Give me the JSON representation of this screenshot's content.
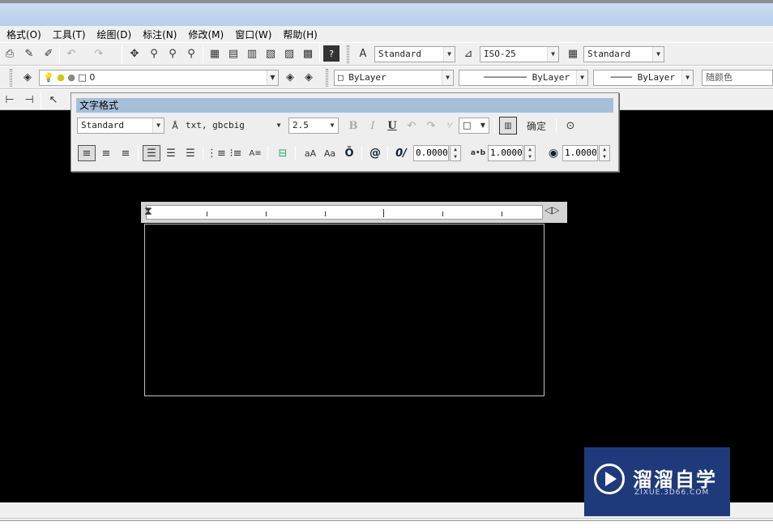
{
  "menubar": {
    "items": [
      "格式(O)",
      "工具(T)",
      "绘图(D)",
      "标注(N)",
      "修改(M)",
      "窗口(W)",
      "帮助(H)"
    ]
  },
  "toolbar_styles": {
    "text_style": "Standard",
    "dim_style": "ISO-25",
    "table_style": "Standard"
  },
  "toolbar_layers": {
    "current_layer": "0",
    "color": "ByLayer",
    "linetype": "ByLayer",
    "lineweight": "ByLayer",
    "plot_style": "随颜色"
  },
  "text_format": {
    "title": "文字格式",
    "style": "Standard",
    "font": "txt, gbcbig",
    "height": "2.5",
    "ok_label": "确定",
    "bold": "B",
    "italic": "I",
    "underline": "U",
    "oblique_angle": "0.0000",
    "tracking": "1.0000",
    "width_factor": "1.0000",
    "symbol": "@",
    "oblique_icon": "0/",
    "tracking_icon": "a•b",
    "upper_lower": "aA",
    "lower": "Aa"
  },
  "watermark": {
    "name": "溜溜自学",
    "url": "ZIXUE.3D66.COM"
  },
  "colors": {
    "canvas": "#000000",
    "titlebar": "#b7cfea",
    "dialog_title": "#a6bfd9",
    "watermark_bg": "#1f3a7a"
  }
}
